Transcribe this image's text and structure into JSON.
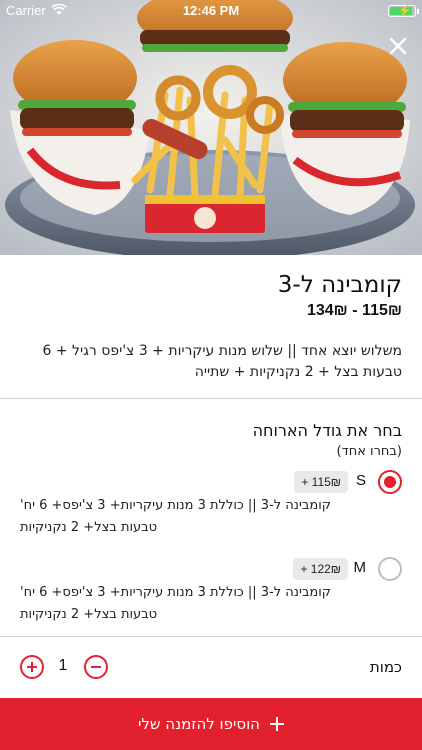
{
  "status_bar": {
    "carrier": "Carrier",
    "time": "12:46 PM",
    "battery_level": 0.9,
    "icons": [
      "wifi-icon",
      "battery-icon",
      "charging-bolt-icon"
    ]
  },
  "hero": {
    "image": "burger-combo-photo",
    "close_icon": "close-icon"
  },
  "product": {
    "title": "קומבינה ל-3",
    "price_range": "115₪ - 134₪",
    "description": "משלוש יוצא אחד || שלוש מנות עיקריות + 3 צ'יפס רגיל + 6 טבעות בצל + 2 נקניקיות + שתייה"
  },
  "size_section": {
    "title": "בחר את גודל הארוחה",
    "subtitle": "(בחרו אחד)",
    "options": [
      {
        "size": "S",
        "price_chip": "+ 115₪",
        "selected": true,
        "description": "קומבינה ל-3 || כוללת 3 מנות עיקריות+ 3 צ'יפס+ 6 יח' טבעות בצל+ 2 נקניקיות"
      },
      {
        "size": "M",
        "price_chip": "+ 122₪",
        "selected": false,
        "description": "קומבינה ל-3 || כוללת 3 מנות עיקריות+ 3 צ'יפס+ 6 יח' טבעות בצל+ 2 נקניקיות"
      }
    ]
  },
  "quantity": {
    "label": "כמות",
    "value": "1",
    "plus_icon": "plus-circle-icon",
    "minus_icon": "minus-circle-icon"
  },
  "cta": {
    "label": "הוסיפו להזמנה שלי",
    "icon": "plus-icon"
  },
  "colors": {
    "accent": "#e3202e",
    "chip_background": "#e9e9e9",
    "divider": "#cfcfcf"
  }
}
